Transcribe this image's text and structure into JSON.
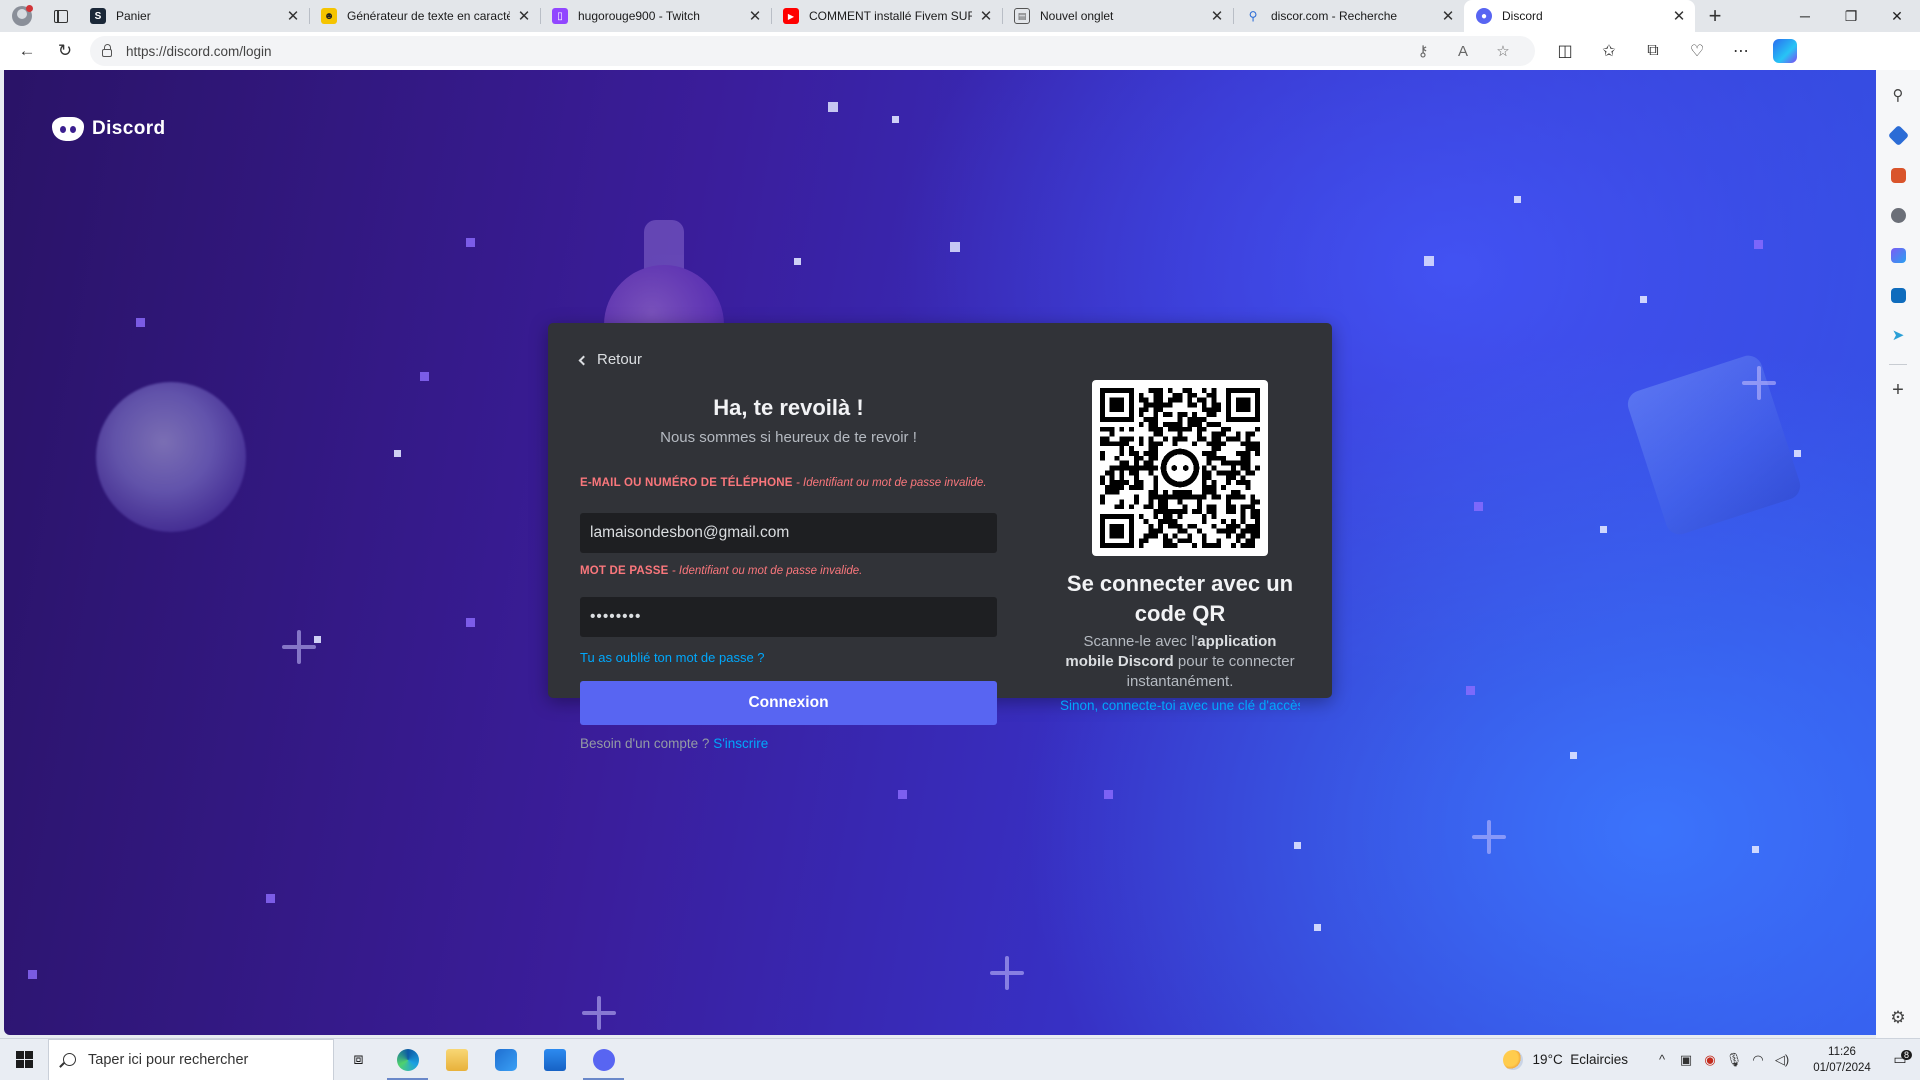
{
  "browser": {
    "tabs": [
      {
        "title": "Panier",
        "favicon": "steam-icon",
        "color": "#1b2838"
      },
      {
        "title": "Générateur de texte en caractè",
        "favicon": "sunglasses-emoji-icon",
        "color": "#f5c400"
      },
      {
        "title": "hugorouge900 - Twitch",
        "favicon": "twitch-icon",
        "color": "#9146ff"
      },
      {
        "title": "COMMENT installé Fivem SUR P",
        "favicon": "youtube-icon",
        "color": "#ff0000"
      },
      {
        "title": "Nouvel onglet",
        "favicon": "new-tab-icon",
        "color": "#555555"
      },
      {
        "title": "discor.com - Recherche",
        "favicon": "search-icon",
        "color": "#2b6cd6"
      },
      {
        "title": "Discord",
        "favicon": "discord-icon",
        "color": "#5865f2",
        "active": true
      }
    ],
    "address": "https://discord.com/login"
  },
  "page": {
    "logo_text": "Discord",
    "back_label": "Retour",
    "heading": "Ha, te revoilà !",
    "subheading": "Nous sommes si heureux de te revoir !",
    "email_label": "E-MAIL OU NUMÉRO DE TÉLÉPHONE",
    "email_error": "- Identifiant ou mot de passe invalide.",
    "email_value": "lamaisondesbon@gmail.com",
    "password_label": "MOT DE PASSE",
    "password_error": "- Identifiant ou mot de passe invalide.",
    "password_value": "••••••••",
    "forgot_label": "Tu as oublié ton mot de passe ?",
    "submit_label": "Connexion",
    "register_prompt": "Besoin d'un compte ?",
    "register_link": "S'inscrire",
    "qr_title": "Se connecter avec un code QR",
    "qr_desc_before": "Scanne-le avec l'",
    "qr_desc_bold": "application mobile Discord",
    "qr_desc_after": " pour te connecter instantanément.",
    "passkey_label": "Sinon, connecte-toi avec une clé d'accès"
  },
  "taskbar": {
    "search_placeholder": "Taper ici pour rechercher",
    "weather_temp": "19°C",
    "weather_desc": "Eclaircies",
    "time": "11:26",
    "date": "01/07/2024",
    "notification_count": "8"
  },
  "colors": {
    "accent": "#5865f2",
    "error": "#fa777c",
    "link": "#00a8fc",
    "card": "#313338",
    "input": "#1e1f22"
  }
}
